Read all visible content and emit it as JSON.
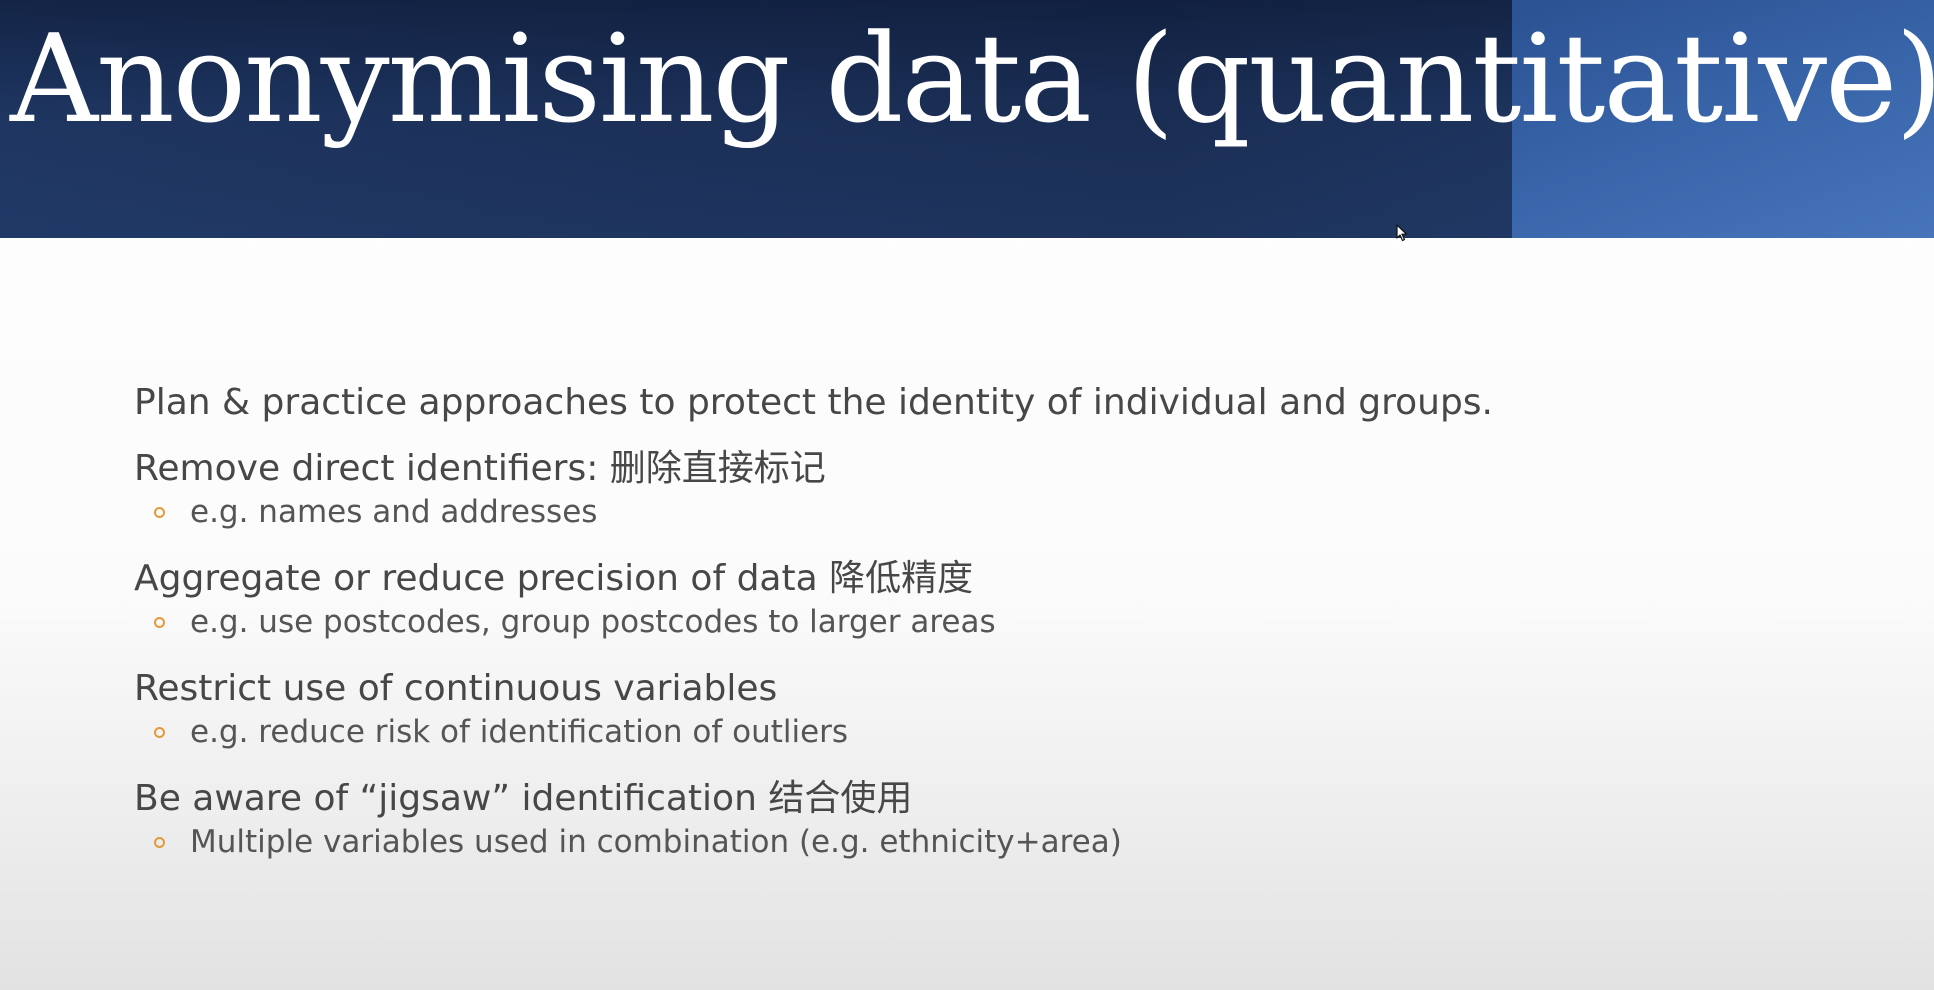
{
  "slide": {
    "title": "Anonymising data (quantitative)"
  },
  "bullets": [
    {
      "text": "Plan & practice approaches to protect the identity of individual and groups.",
      "sub": []
    },
    {
      "text": "Remove direct identifiers: 删除直接标记",
      "sub": [
        "e.g. names and addresses"
      ]
    },
    {
      "text": "Aggregate or reduce precision of data 降低精度",
      "sub": [
        "e.g. use postcodes, group postcodes to larger areas"
      ]
    },
    {
      "text": "Restrict use of continuous variables",
      "sub": [
        "e.g. reduce risk of identification of outliers"
      ]
    },
    {
      "text": "Be aware of “jigsaw” identification 结合使用",
      "sub": [
        "Multiple variables used in combination (e.g. ethnicity+area)"
      ]
    }
  ],
  "colors": {
    "header_bg": "#1b2f57",
    "header_accent": "#3a67ad",
    "title_text": "#ffffff",
    "body_text": "#474747",
    "sub_bullet_marker": "#e29a3a"
  },
  "icons": {
    "cursor": "mouse-pointer-icon",
    "sub_bullet": "hollow-circle-bullet"
  }
}
